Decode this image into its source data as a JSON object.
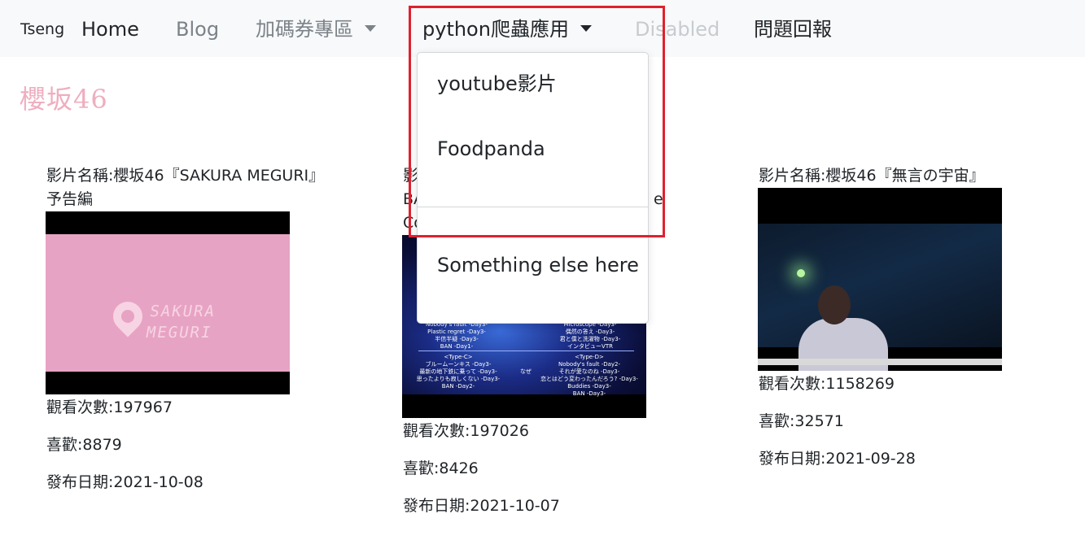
{
  "navbar": {
    "brand": "Tseng",
    "home": "Home",
    "blog": "Blog",
    "coupon": "加碼券專區",
    "python": "python爬蟲應用",
    "disabled": "Disabled",
    "report": "問題回報"
  },
  "logo": "櫻坂46",
  "videos": [
    {
      "title": "影片名稱:櫻坂46『SAKURA MEGURI』予告編",
      "thumb_text": "SAKURA\nMEGURI",
      "views": "觀看次數:197967",
      "likes": "喜歡:8879",
      "date": "發布日期:2021-10-08"
    },
    {
      "title": "影",
      "title_line2": "BA",
      "title_line2_tail": "e",
      "title_line3": "Co",
      "thumb_text_left": "Nobody's fault -Day3-\nPlastic regret -Day3-\n半信半疑 -Day3-\nBAN -Day1-",
      "thumb_text_right": "Microscope -Day3-\n偶然の答え -Day3-\n君と僕と洗濯物 -Day3-\nインタビューVTR",
      "thumb_text_left2": "<Type-C>\nブルームーンキス -Day3-\n最新の地下鉄に乗って -Day3-\n思ったよりも寂しくない -Day3-\nBAN -Day2-",
      "thumb_text_right2": "<Type-D>\nNobody's fault -Day2-\nそれが愛なのね -Day3-\n恋とはどう変わったんだろう? -Day3-\nBuddies -Day3-\nBAN -Day3-",
      "thumb_text_naze": "なぜ",
      "views": "觀看次數:197026",
      "likes": "喜歡:8426",
      "date": "發布日期:2021-10-07"
    },
    {
      "title": "影片名稱:櫻坂46『無言の宇宙』",
      "views": "觀看次數:1158269",
      "likes": "喜歡:32571",
      "date": "發布日期:2021-09-28"
    }
  ],
  "dropdown": {
    "items": [
      "youtube影片",
      "Foodpanda",
      "Something else here"
    ]
  },
  "colors": {
    "highlight": "#e0202e",
    "logo": "#eeaebf",
    "navbar_bg": "#f8f9fa"
  }
}
